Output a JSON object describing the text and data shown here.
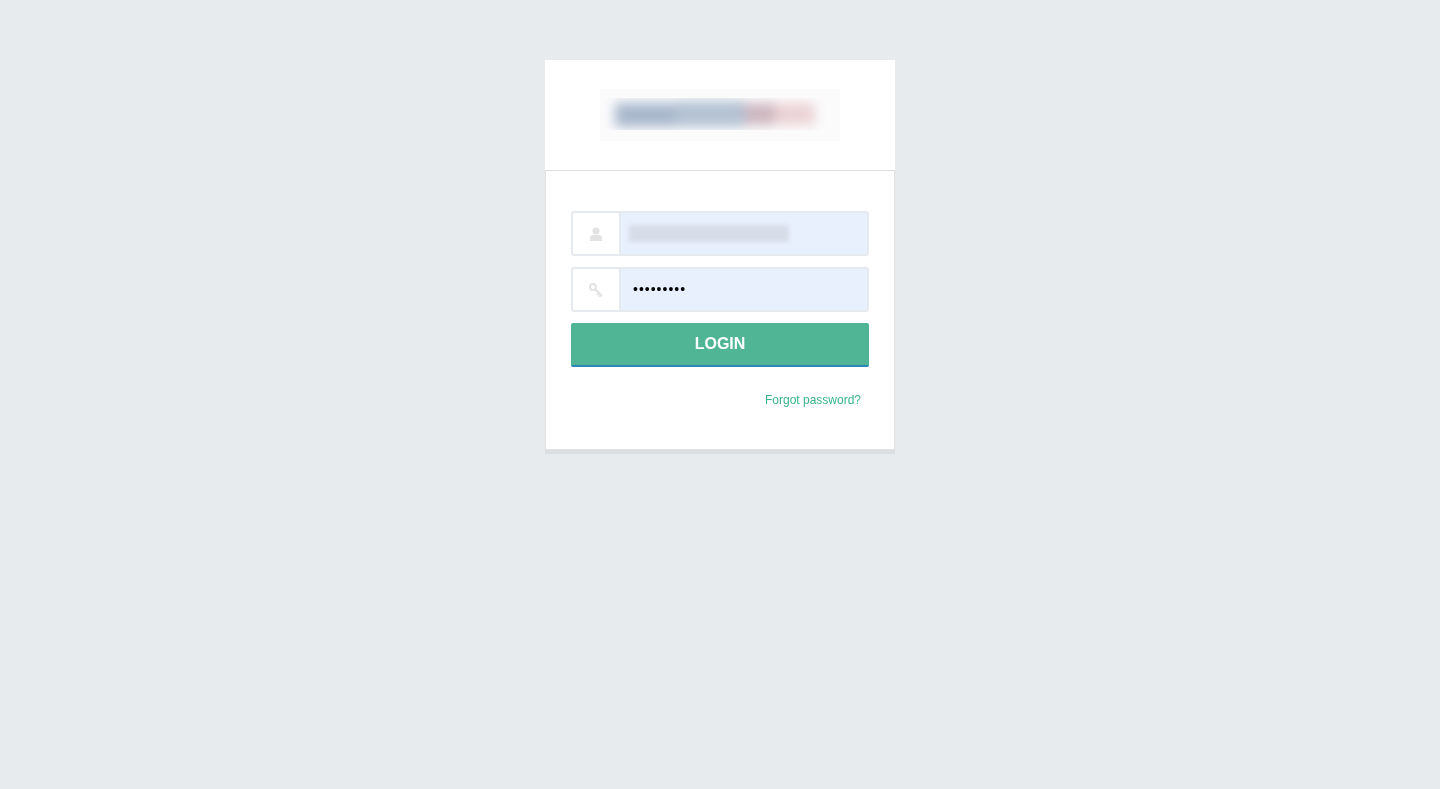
{
  "username": {
    "redacted": true
  },
  "password": {
    "value": "•••••••••"
  },
  "login_button": {
    "label": "LOGIN"
  },
  "forgot_link": {
    "label": "Forgot password?"
  }
}
